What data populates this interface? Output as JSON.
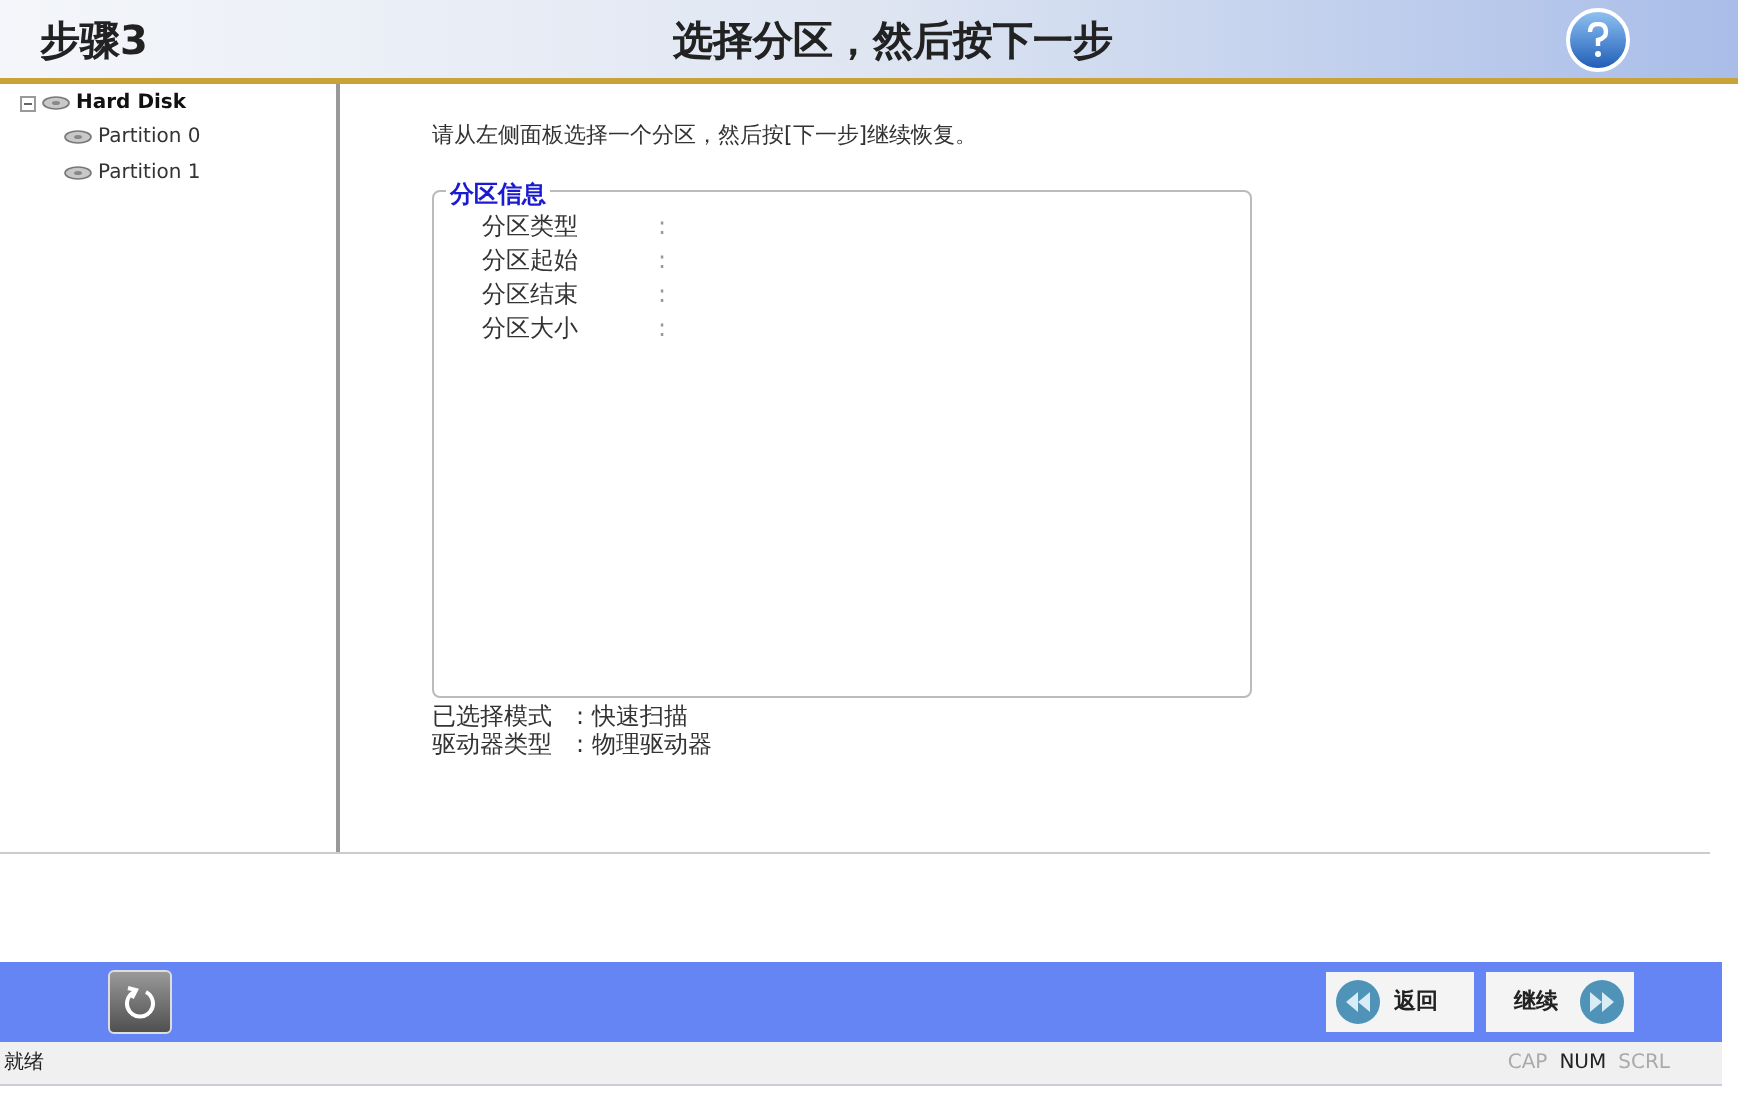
{
  "header": {
    "step": "步骤3",
    "title": "选择分区，然后按下一步"
  },
  "tree": {
    "label": "Hard Disk",
    "expanded": true,
    "children": [
      {
        "label": "Partition 0"
      },
      {
        "label": "Partition 1"
      }
    ]
  },
  "instruction": "请从左侧面板选择一个分区，然后按[下一步]继续恢复。",
  "partition_info": {
    "legend": "分区信息",
    "fields": [
      {
        "label": "分区类型",
        "separator": ":"
      },
      {
        "label": "分区起始",
        "separator": ":"
      },
      {
        "label": "分区结束",
        "separator": ":"
      },
      {
        "label": "分区大小",
        "separator": ":"
      }
    ]
  },
  "summary": [
    {
      "label": "已选择模式",
      "separator": ":",
      "value": "快速扫描"
    },
    {
      "label": "驱动器类型",
      "separator": ":",
      "value": "物理驱动器"
    }
  ],
  "footer": {
    "back": "返回",
    "next": "继续"
  },
  "status_bar": {
    "text": "就绪",
    "indicators": [
      {
        "label": "CAP",
        "on": false
      },
      {
        "label": "NUM",
        "on": true
      },
      {
        "label": "SCRL",
        "on": false
      }
    ]
  }
}
